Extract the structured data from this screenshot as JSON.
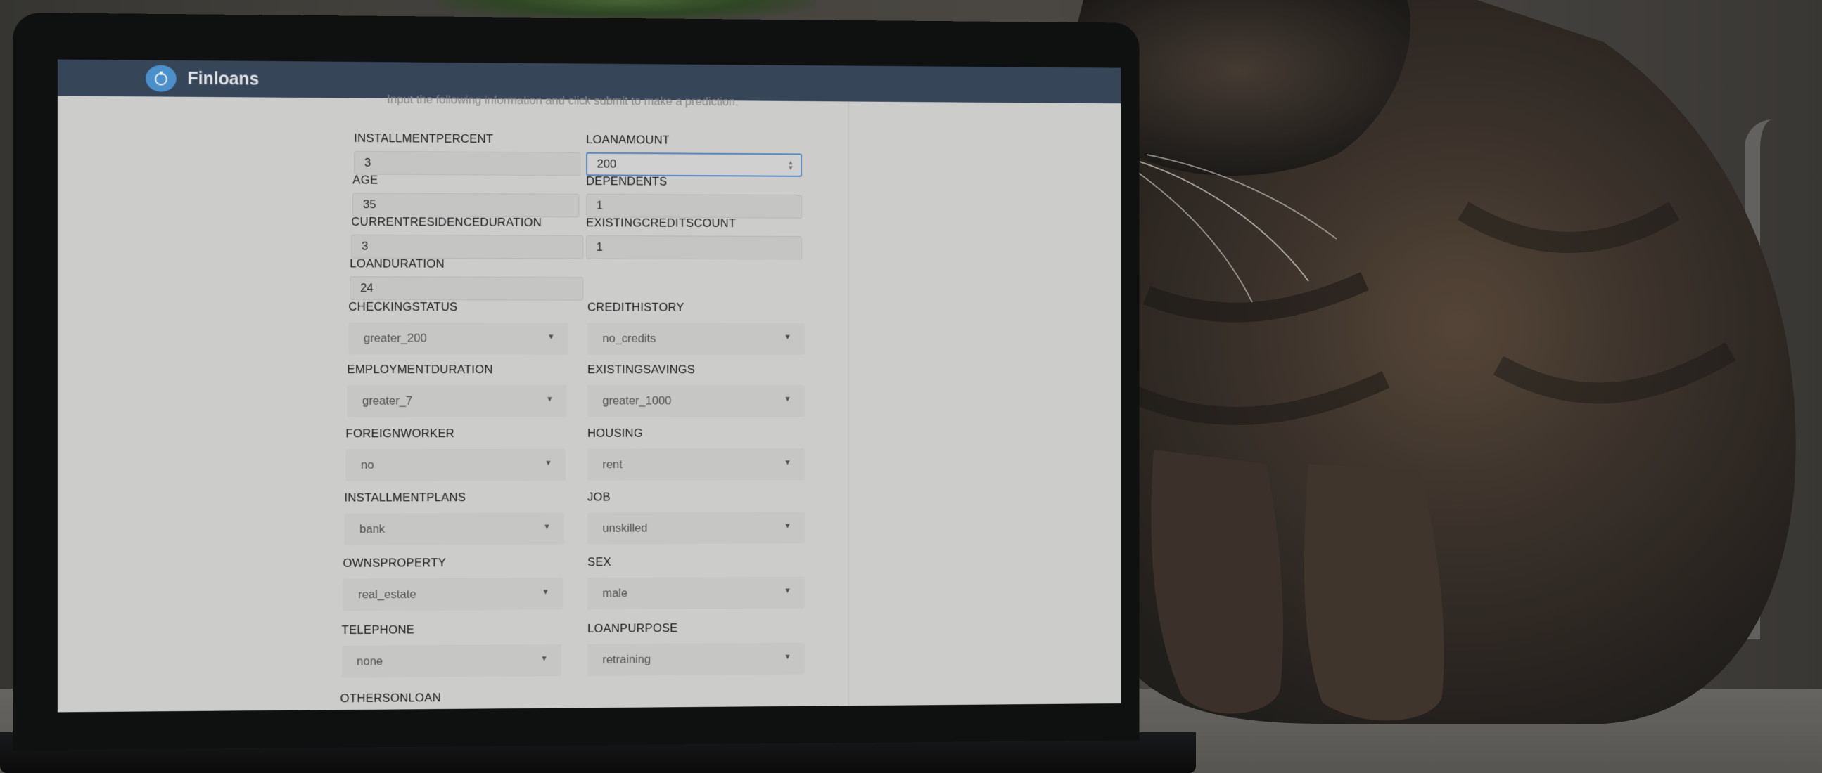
{
  "app": {
    "name": "Finloans",
    "instructions": "Input the following information and click submit to make a prediction."
  },
  "number_fields": [
    {
      "label": "INSTALLMENTPERCENT",
      "value": "3"
    },
    {
      "label": "LOANAMOUNT",
      "value": "200"
    },
    {
      "label": "AGE",
      "value": "35"
    },
    {
      "label": "DEPENDENTS",
      "value": "1"
    },
    {
      "label": "CURRENTRESIDENCEDURATION",
      "value": "3"
    },
    {
      "label": "EXISTINGCREDITSCOUNT",
      "value": "1"
    },
    {
      "label": "LOANDURATION",
      "value": "24"
    }
  ],
  "select_fields": [
    {
      "label": "CHECKINGSTATUS",
      "value": "greater_200"
    },
    {
      "label": "CREDITHISTORY",
      "value": "no_credits"
    },
    {
      "label": "EMPLOYMENTDURATION",
      "value": "greater_7"
    },
    {
      "label": "EXISTINGSAVINGS",
      "value": "greater_1000"
    },
    {
      "label": "FOREIGNWORKER",
      "value": "no"
    },
    {
      "label": "HOUSING",
      "value": "rent"
    },
    {
      "label": "INSTALLMENTPLANS",
      "value": "bank"
    },
    {
      "label": "JOB",
      "value": "unskilled"
    },
    {
      "label": "OWNSPROPERTY",
      "value": "real_estate"
    },
    {
      "label": "SEX",
      "value": "male"
    },
    {
      "label": "TELEPHONE",
      "value": "none"
    },
    {
      "label": "LOANPURPOSE",
      "value": "retraining"
    }
  ],
  "partial_field": {
    "label": "OTHERSONLOAN"
  },
  "icons": {
    "brand": "piggy-bank-icon",
    "dropdown": "caret-down-icon",
    "spinner": "number-spinner-icon"
  },
  "colors": {
    "topbar": "#3b4a5f",
    "brand_icon": "#4f9bd9",
    "screen_bg": "#d9d9d8",
    "focus_border": "#5d8fc9"
  }
}
